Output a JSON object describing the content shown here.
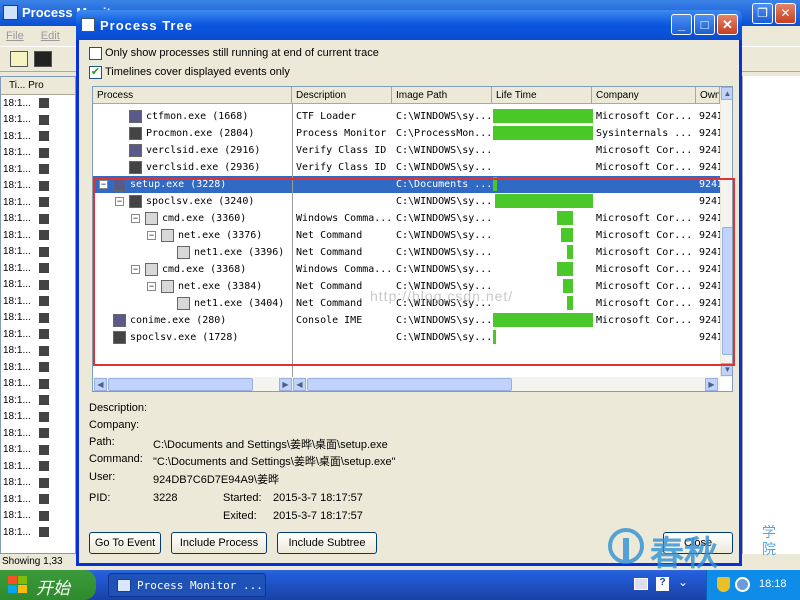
{
  "background_window": {
    "title": "Process Monitor",
    "menu": [
      "File",
      "Edit"
    ],
    "list_header": "Ti... Pro",
    "row_time": "18:1...",
    "status": "Showing 1,33"
  },
  "dialog": {
    "title": "Process Tree",
    "option1": "Only show processes still running at end of current trace",
    "option2": "Timelines cover displayed events only",
    "option1_checked": false,
    "option2_checked": true,
    "columns": [
      "Process",
      "Description",
      "Image Path",
      "Life Time",
      "Company",
      "Own"
    ],
    "rows": [
      {
        "name": "ctfmon.exe (1668)",
        "desc": "CTF Loader",
        "path": "C:\\WINDOWS\\sy...",
        "company": "Microsoft Cor...",
        "owner": "924I",
        "indent": 2,
        "life": [
          0.0,
          1.0
        ],
        "selected": false
      },
      {
        "name": "Procmon.exe (2804)",
        "desc": "Process Monitor",
        "path": "C:\\ProcessMon...",
        "company": "Sysinternals ...",
        "owner": "924I",
        "indent": 2,
        "life": [
          0.0,
          1.0
        ],
        "selected": false
      },
      {
        "name": "verclsid.exe (2916)",
        "desc": "Verify Class ID",
        "path": "C:\\WINDOWS\\sy...",
        "company": "Microsoft Cor...",
        "owner": "924I",
        "indent": 2,
        "life": null,
        "selected": false
      },
      {
        "name": "verclsid.exe (2936)",
        "desc": "Verify Class ID",
        "path": "C:\\WINDOWS\\sy...",
        "company": "Microsoft Cor...",
        "owner": "924I",
        "indent": 2,
        "life": null,
        "selected": false
      },
      {
        "name": "setup.exe (3228)",
        "desc": "",
        "path": "C:\\Documents ...",
        "company": "",
        "owner": "924I",
        "indent": 1,
        "life": [
          0.0,
          0.04
        ],
        "selected": true,
        "expand": "−"
      },
      {
        "name": "spoclsv.exe (3240)",
        "desc": "",
        "path": "C:\\WINDOWS\\sy...",
        "company": "",
        "owner": "924I",
        "indent": 2,
        "life": [
          0.02,
          1.0
        ],
        "selected": false,
        "expand": "−"
      },
      {
        "name": "cmd.exe (3360)",
        "desc": "Windows Comma...",
        "path": "C:\\WINDOWS\\sy...",
        "company": "Microsoft Cor...",
        "owner": "924I",
        "indent": 3,
        "life": [
          0.64,
          0.8
        ],
        "selected": false,
        "expand": "−"
      },
      {
        "name": "net.exe (3376)",
        "desc": "Net Command",
        "path": "C:\\WINDOWS\\sy...",
        "company": "Microsoft Cor...",
        "owner": "924I",
        "indent": 4,
        "life": [
          0.68,
          0.8
        ],
        "selected": false,
        "expand": "−"
      },
      {
        "name": "net1.exe (3396)",
        "desc": "Net Command",
        "path": "C:\\WINDOWS\\sy...",
        "company": "Microsoft Cor...",
        "owner": "924I",
        "indent": 5,
        "life": [
          0.74,
          0.8
        ],
        "selected": false
      },
      {
        "name": "cmd.exe (3368)",
        "desc": "Windows Comma...",
        "path": "C:\\WINDOWS\\sy...",
        "company": "Microsoft Cor...",
        "owner": "924I",
        "indent": 3,
        "life": [
          0.64,
          0.8
        ],
        "selected": false,
        "expand": "−"
      },
      {
        "name": "net.exe (3384)",
        "desc": "Net Command",
        "path": "C:\\WINDOWS\\sy...",
        "company": "Microsoft Cor...",
        "owner": "924I",
        "indent": 4,
        "life": [
          0.7,
          0.8
        ],
        "selected": false,
        "expand": "−"
      },
      {
        "name": "net1.exe (3404)",
        "desc": "Net Command",
        "path": "C:\\WINDOWS\\sy...",
        "company": "Microsoft Cor...",
        "owner": "924I",
        "indent": 5,
        "life": [
          0.74,
          0.8
        ],
        "selected": false
      },
      {
        "name": "conime.exe (280)",
        "desc": "Console IME",
        "path": "C:\\WINDOWS\\sy...",
        "company": "Microsoft Cor...",
        "owner": "924I",
        "indent": 1,
        "life": [
          0.0,
          1.0
        ],
        "selected": false
      },
      {
        "name": "spoclsv.exe (1728)",
        "desc": "",
        "path": "C:\\WINDOWS\\sy...",
        "company": "",
        "owner": "924I",
        "indent": 1,
        "life": [
          0.0,
          0.03
        ],
        "selected": false
      }
    ],
    "details": {
      "description_label": "Description:",
      "company_label": "Company:",
      "path_label": "Path:",
      "path_value": "C:\\Documents and Settings\\姜晔\\桌面\\setup.exe",
      "command_label": "Command:",
      "command_value": "\"C:\\Documents and Settings\\姜晔\\桌面\\setup.exe\"",
      "user_label": "User:",
      "user_value": "924DB7C6D7E94A9\\姜晔",
      "pid_label": "PID:",
      "pid_value": "3228",
      "started_label": "Started:",
      "started_value": "2015-3-7 18:17:57",
      "exited_label": "Exited:",
      "exited_value": "2015-3-7 18:17:57"
    },
    "buttons": {
      "go_to_event": "Go To Event",
      "include_process": "Include Process",
      "include_subtree": "Include Subtree",
      "close": "Close"
    }
  },
  "watermark": {
    "brand": "春秋",
    "side": "学院",
    "url": "http://blog.csdn.net/"
  },
  "taskbar": {
    "start": "开始",
    "task": "Process Monitor ...",
    "clock": "18:18"
  },
  "colors": {
    "selection": "#316ac5",
    "lifebar": "#4ac82a",
    "highlight_box": "#dd3333",
    "title_blue": "#0a56e0"
  }
}
